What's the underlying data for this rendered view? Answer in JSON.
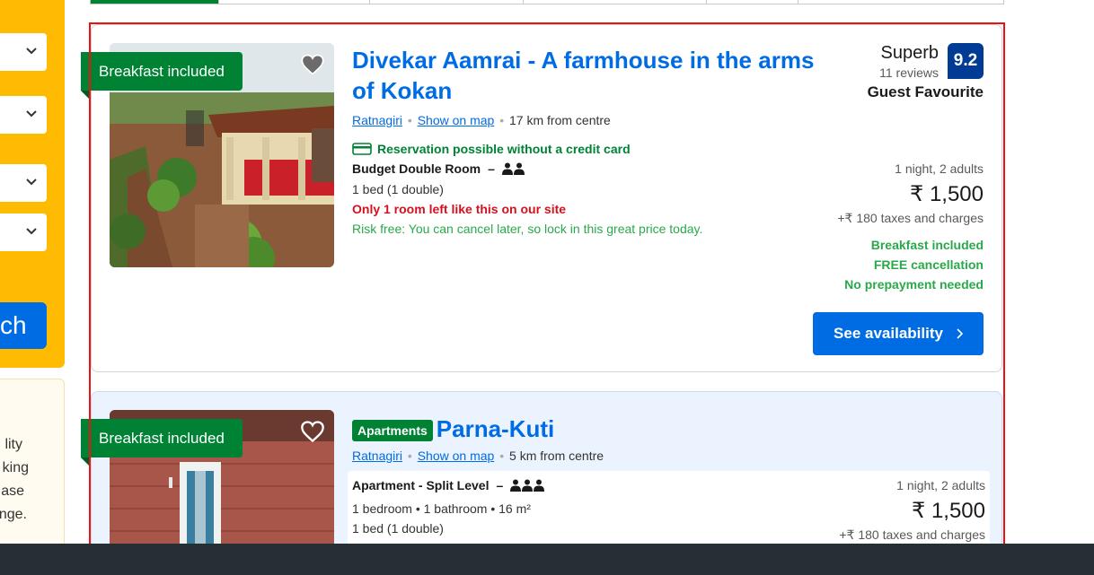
{
  "sidebar": {
    "search_label": "ch",
    "note_lines": [
      "lity",
      "king",
      "ase",
      "nge."
    ]
  },
  "tabs": [
    {
      "label": ""
    },
    {
      "label": ""
    },
    {
      "label": ""
    },
    {
      "label": ""
    },
    {
      "label": ""
    },
    {
      "label": ""
    }
  ],
  "listings": [
    {
      "ribbon": "Breakfast included",
      "title": "Divekar Aamrai - A farmhouse in the arms of Kokan",
      "location": "Ratnagiri",
      "show_on_map": "Show on map",
      "distance": "17 km from centre",
      "credit_card_note": "Reservation possible without a credit card",
      "room_name": "Budget Double Room",
      "room_dash": "–",
      "bed": "1 bed (1 double)",
      "scarcity": "Only 1 room left like this on our site",
      "risk_free": "Risk free: You can cancel later, so lock in this great price today.",
      "rating_word": "Superb",
      "reviews": "11 reviews",
      "score": "9.2",
      "guest_favourite": "Guest Favourite",
      "nights": "1 night, 2 adults",
      "price": "₹ 1,500",
      "taxes": "+₹ 180 taxes and charges",
      "perks": [
        "Breakfast included",
        "FREE cancellation",
        "No prepayment needed"
      ],
      "button": "See availability"
    },
    {
      "ribbon": "Breakfast included",
      "badge": "Apartments",
      "title": "Parna-Kuti",
      "location": "Ratnagiri",
      "show_on_map": "Show on map",
      "distance": "5 km from centre",
      "room_name": "Apartment - Split Level",
      "room_dash": "–",
      "details": "1 bedroom • 1 bathroom • 16 m²",
      "bed": "1 bed (1 double)",
      "nights": "1 night, 2 adults",
      "price": "₹ 1,500",
      "taxes": "+₹ 180 taxes and charges"
    }
  ],
  "colors": {
    "brand_blue": "#006ce4",
    "sidebar_yellow": "#febb02",
    "green": "#008234",
    "score_blue": "#003b95",
    "highlight_red": "#e11111"
  }
}
